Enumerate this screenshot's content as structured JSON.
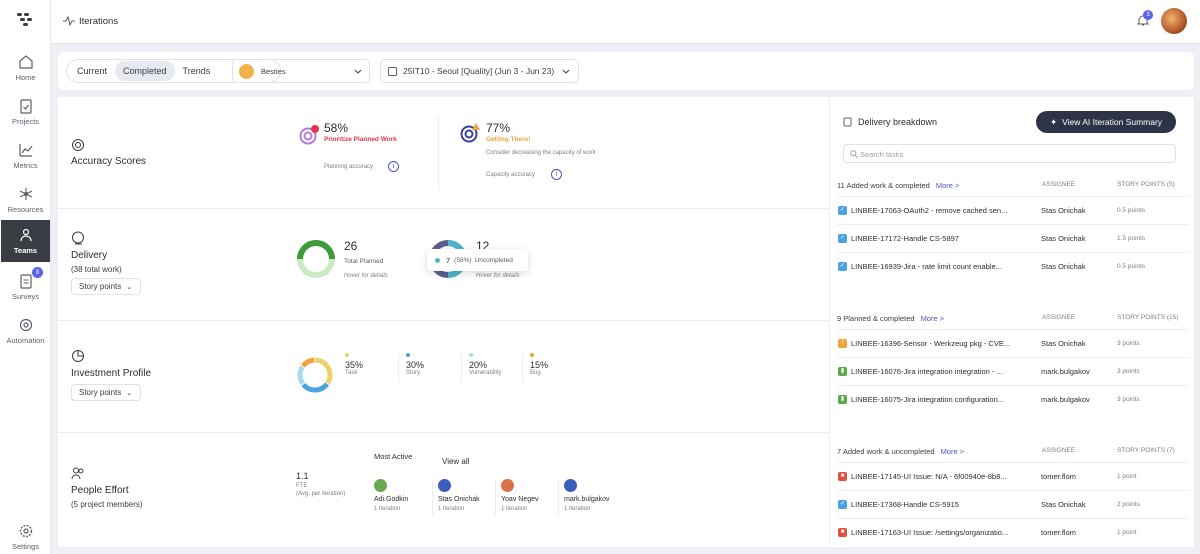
{
  "app": {
    "title": "Iterations"
  },
  "notifications": {
    "count": "3"
  },
  "sidebar": {
    "items": [
      {
        "label": "Home"
      },
      {
        "label": "Projects"
      },
      {
        "label": "Metrics"
      },
      {
        "label": "Resources"
      },
      {
        "label": "Teams"
      },
      {
        "label": "Surveys",
        "badge": "8"
      },
      {
        "label": "Automation"
      },
      {
        "label": "Settings"
      }
    ]
  },
  "filters": {
    "tabs": [
      "Current",
      "Completed",
      "Trends"
    ],
    "team": "Besties",
    "iteration": "25IT10 - Seoul [Quality] (Jun 3 - Jun 23)"
  },
  "accuracy": {
    "title": "Accuracy Scores",
    "planning": {
      "value": "58%",
      "status": "Prioritize Planned Work",
      "label": "Planning accuracy",
      "fraction": 0.58
    },
    "capacity": {
      "value": "77%",
      "status": "Getting There!",
      "note": "Consider decreasing the capacity of work",
      "label": "Capacity accuracy",
      "fraction": 0.77
    }
  },
  "delivery": {
    "title": "Delivery",
    "subtitle": "(38 total work)",
    "unit_button": "Story points",
    "planned": {
      "value": "26",
      "label": "Total Planned",
      "hint": "Hover for details"
    },
    "unplanned": {
      "value": "12",
      "hint": "Hover for details"
    },
    "tooltip": {
      "count": "7",
      "pct": "(58%)",
      "label": "Uncompleted"
    }
  },
  "investment": {
    "title": "Investment Profile",
    "unit_button": "Story points",
    "items": [
      {
        "pct": "35%",
        "label": "Task",
        "color": "#e9d36a"
      },
      {
        "pct": "30%",
        "label": "Story",
        "color": "#4aa3df"
      },
      {
        "pct": "20%",
        "label": "Vulnerability",
        "color": "#a6d8f2"
      },
      {
        "pct": "15%",
        "label": "Bug",
        "color": "#f0a23b"
      }
    ]
  },
  "people": {
    "title": "People Effort",
    "subtitle": "(5 project members)",
    "fte": {
      "value": "1.1",
      "unit": "FTE",
      "note": "(Avg. per iteration)"
    },
    "most_active_label": "Most Active",
    "view_all": "View all",
    "members": [
      {
        "name": "Adi.Godkin",
        "iterations": "1 iteration"
      },
      {
        "name": "Stas Onichak",
        "iterations": "1 iteration"
      },
      {
        "name": "Yoav Negev",
        "iterations": "1 iteration"
      },
      {
        "name": "mark.bulgakov",
        "iterations": "1 iteration"
      }
    ]
  },
  "breakdown": {
    "title": "Delivery breakdown",
    "ai_button": "View AI Iteration Summary",
    "search_placeholder": "Search tasks",
    "assignee_header": "ASSIGNEE",
    "groups": [
      {
        "label": "11 Added work & completed",
        "more": "More >",
        "points_header": "STORY POINTS (5)",
        "rows": [
          {
            "id": "LINBEE-17063-OAuth2 - remove cached sen...",
            "assignee": "Stas Onichak",
            "points": "0.5 points",
            "type": "task"
          },
          {
            "id": "LINBEE-17172-Handle CS-5897",
            "assignee": "Stas Onichak",
            "points": "1.5 points",
            "type": "task"
          },
          {
            "id": "LINBEE-16939-Jira - rate limit count enable...",
            "assignee": "Stas Onichak",
            "points": "0.5 points",
            "type": "task"
          }
        ]
      },
      {
        "label": "9 Planned & completed",
        "more": "More >",
        "points_header": "STORY POINTS (15)",
        "rows": [
          {
            "id": "LINBEE-16396-Sensor - Werkzeug pkg - CVE...",
            "assignee": "Stas Onichak",
            "points": "3 points",
            "type": "vuln"
          },
          {
            "id": "LINBEE-16076-Jira integration integration - ...",
            "assignee": "mark.bulgakov",
            "points": "3 points",
            "type": "story"
          },
          {
            "id": "LINBEE-16075-Jira integration configuration...",
            "assignee": "mark.bulgakov",
            "points": "3 points",
            "type": "story"
          }
        ]
      },
      {
        "label": "7 Added work & uncompleted",
        "more": "More >",
        "points_header": "STORY POINTS (7)",
        "rows": [
          {
            "id": "LINBEE-17145-UI Issue: N/A - 6f00940e-8b8...",
            "assignee": "tomer.flom",
            "points": "1 point",
            "type": "bug"
          },
          {
            "id": "LINBEE-17368-Handle CS-5915",
            "assignee": "Stas Onichak",
            "points": "2 points",
            "type": "task"
          },
          {
            "id": "LINBEE-17163-UI Issue: /settings/organizatio...",
            "assignee": "tomer.flom",
            "points": "1 point",
            "type": "bug"
          }
        ]
      }
    ]
  }
}
